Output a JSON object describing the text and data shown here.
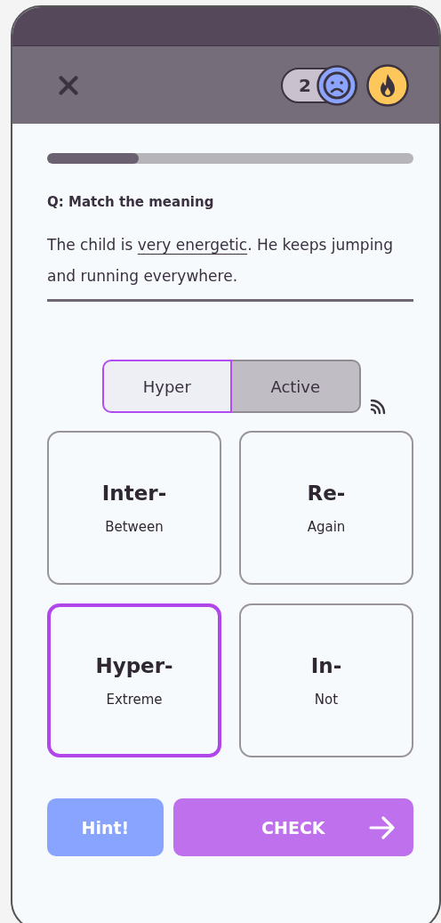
{
  "header": {
    "lives": "2"
  },
  "progress": {
    "level": 0.25
  },
  "question": {
    "label": "Q: Match the meaning",
    "before": "The child is ",
    "highlight": "very energetic",
    "after": ". He keeps jumping and running everywhere."
  },
  "answer_parts": [
    {
      "label": "Hyper",
      "selected": true
    },
    {
      "label": "Active",
      "selected": false
    }
  ],
  "cards": [
    {
      "prefix": "Inter-",
      "meaning": "Between",
      "selected": false
    },
    {
      "prefix": "Re-",
      "meaning": "Again",
      "selected": false
    },
    {
      "prefix": "Hyper-",
      "meaning": "Extreme",
      "selected": true
    },
    {
      "prefix": "In-",
      "meaning": "Not",
      "selected": false
    }
  ],
  "buttons": {
    "hint": "Hint!",
    "check": "CHECK"
  }
}
